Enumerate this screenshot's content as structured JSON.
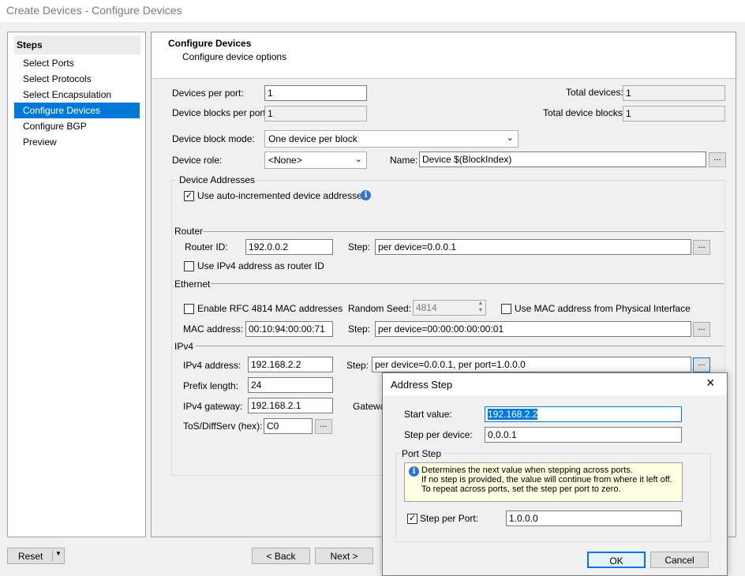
{
  "window": {
    "title": "Create Devices - Configure Devices"
  },
  "steps": {
    "header": "Steps",
    "items": [
      {
        "label": "Select Ports"
      },
      {
        "label": "Select Protocols"
      },
      {
        "label": "Select Encapsulation"
      },
      {
        "label": "Configure Devices",
        "active": true
      },
      {
        "label": "Configure BGP"
      },
      {
        "label": "Preview"
      }
    ]
  },
  "page": {
    "title": "Configure Devices",
    "subtitle": "Configure device options"
  },
  "form": {
    "devices_per_port_label": "Devices per port:",
    "devices_per_port": "1",
    "device_blocks_per_port_label": "Device blocks per port:",
    "device_blocks_per_port": "1",
    "total_devices_label": "Total devices:",
    "total_devices": "1",
    "total_device_blocks_label": "Total device blocks:",
    "total_device_blocks": "1",
    "block_mode_label": "Device block mode:",
    "block_mode": "One device per block",
    "role_label": "Device role:",
    "role": "<None>",
    "name_label": "Name:",
    "name": "Device $(BlockIndex)",
    "ellipsis": "..."
  },
  "addresses": {
    "group_label": "Device Addresses",
    "auto_increment_label": "Use auto-incremented device addresses",
    "auto_increment_checked": true,
    "router": {
      "section": "Router",
      "router_id_label": "Router ID:",
      "router_id": "192.0.0.2",
      "step_label": "Step:",
      "step": "per device=0.0.0.1",
      "use_ipv4_label": "Use IPv4 address as router ID"
    },
    "ethernet": {
      "section": "Ethernet",
      "rfc4814_label": "Enable RFC 4814 MAC addresses",
      "random_seed_label": "Random Seed:",
      "random_seed": "4814",
      "use_mac_label": "Use MAC address from Physical Interface",
      "mac_label": "MAC address:",
      "mac": "00:10:94:00:00:71",
      "step_label": "Step:",
      "step": "per device=00:00:00:00:00:01"
    },
    "ipv4": {
      "section": "IPv4",
      "address_label": "IPv4 address:",
      "address": "192.168.2.2",
      "step_label": "Step:",
      "step": "per device=0.0.0.1, per port=1.0.0.0",
      "prefix_label": "Prefix length:",
      "prefix": "24",
      "gateway_label": "IPv4 gateway:",
      "gateway": "192.168.2.1",
      "gateway_partial_label": "Gatewa",
      "tos_label": "ToS/DiffServ (hex):",
      "tos": "C0"
    }
  },
  "footer": {
    "reset": "Reset",
    "back": "< Back",
    "next": "Next >"
  },
  "dialog": {
    "title": "Address Step",
    "close": "×",
    "start_value_label": "Start value:",
    "start_value": "192.168.2.2",
    "step_per_device_label": "Step per device:",
    "step_per_device": "0.0.0.1",
    "port_step_group": "Port Step",
    "info_line1": "Determines the next value when stepping across ports.",
    "info_line2": "If no step is provided, the value will continue from where it left off.",
    "info_line3": "To repeat across ports, set the step per port to zero.",
    "step_per_port_label": "Step per Port:",
    "step_per_port_checked": true,
    "step_per_port": "1.0.0.0",
    "ok": "OK",
    "cancel": "Cancel"
  },
  "colors": {
    "accent": "#0078d7",
    "info_bg": "#ffffe1",
    "info_icon": "#2e73d6"
  },
  "icons": [
    "info-icon",
    "close-icon",
    "chevron-down-icon",
    "spinner-arrows-icon",
    "dropdown-arrow-icon"
  ]
}
